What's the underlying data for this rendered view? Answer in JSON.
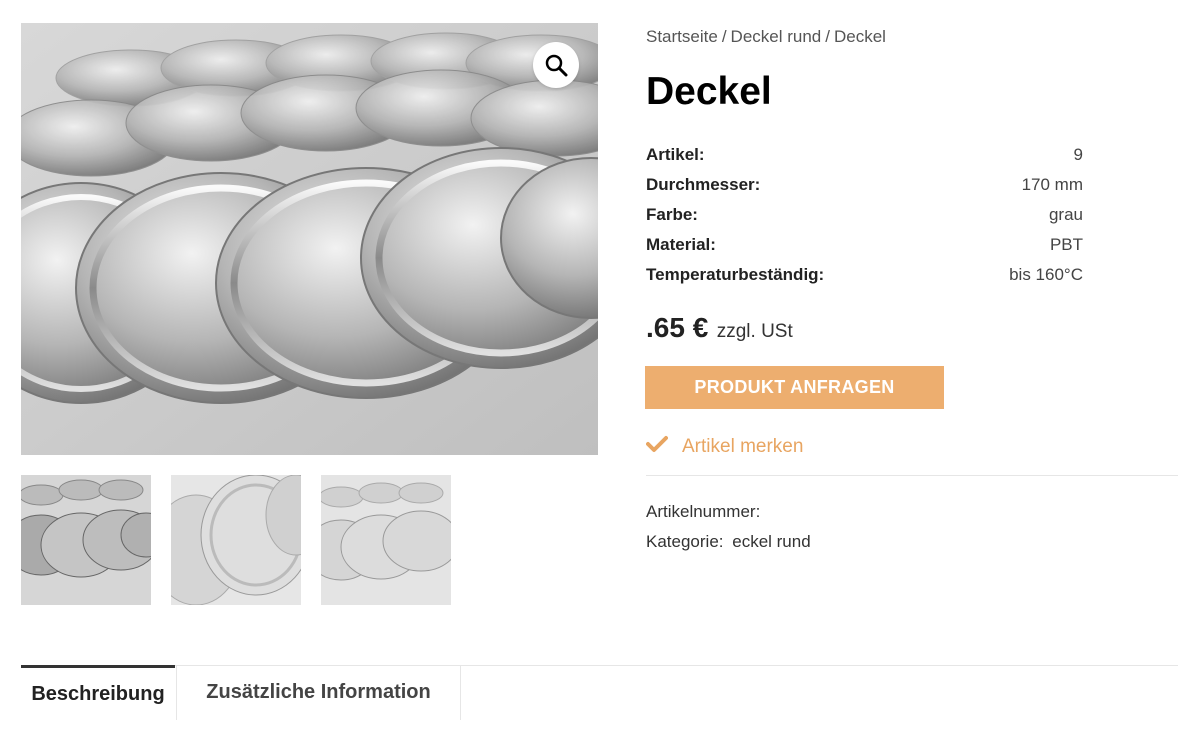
{
  "breadcrumb": {
    "home": "Startseite",
    "category": "Deckel rund",
    "current": "Deckel"
  },
  "product": {
    "title": "Deckel",
    "price": ".65 €",
    "tax_note": "zzgl. USt"
  },
  "specs": [
    {
      "label": "Artikel:",
      "value": "9"
    },
    {
      "label": "Durchmesser:",
      "value": "170 mm"
    },
    {
      "label": "Farbe:",
      "value": "grau"
    },
    {
      "label": "Material:",
      "value": "PBT"
    },
    {
      "label": "Temperaturbeständig:",
      "value": "bis 160°C"
    }
  ],
  "cta_label": "PRODUKT ANFRAGEN",
  "wishlist_label": "Artikel merken",
  "meta": {
    "sku_label": "Artikelnummer:",
    "sku_value": "",
    "category_label": "Kategorie:",
    "category_value": "eckel rund"
  },
  "tabs": [
    {
      "label": "Beschreibung",
      "active": true
    },
    {
      "label": "Zusätzliche Information",
      "active": false
    }
  ],
  "icons": {
    "zoom": "magnifier-icon",
    "wishlist": "check-icon"
  },
  "colors": {
    "accent": "#edae6f",
    "wishlist": "#e8a561"
  }
}
